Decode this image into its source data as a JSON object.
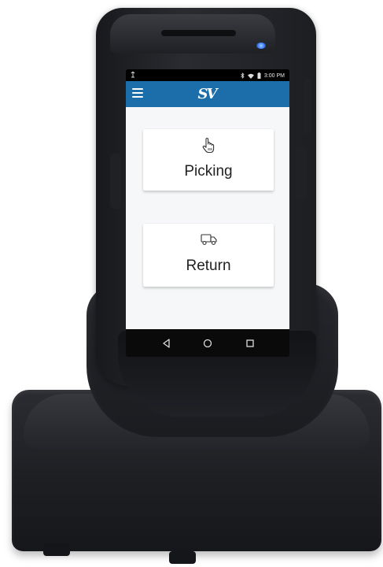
{
  "device": {
    "name": "handheld-scanner-in-cradle"
  },
  "status_bar": {
    "time": "3:00 PM",
    "icons": [
      "usb-icon",
      "bluetooth-icon",
      "wifi-icon",
      "battery-icon"
    ]
  },
  "app_bar": {
    "menu_icon": "hamburger-menu-icon",
    "logo_text": "SV",
    "color": "#1c6eab"
  },
  "menu": {
    "items": [
      {
        "label": "Picking",
        "icon": "hand-pointer-icon"
      },
      {
        "label": "Return",
        "icon": "truck-icon"
      }
    ]
  },
  "nav_bar": {
    "buttons": [
      "back-icon",
      "home-icon",
      "recent-apps-icon"
    ]
  },
  "colors": {
    "accent": "#1c6eab",
    "led": "#3b7dff"
  }
}
